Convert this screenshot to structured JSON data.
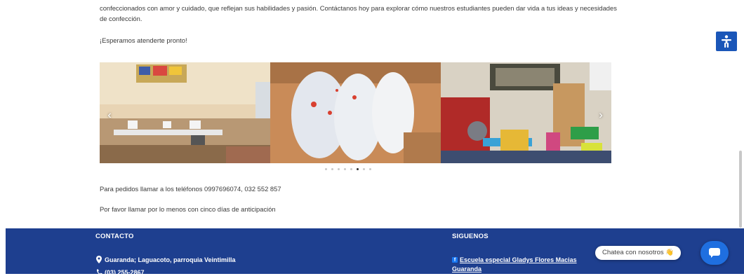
{
  "main": {
    "intro": "confeccionados con amor y cuidado, que reflejan sus habilidades y pasión. Contáctanos hoy para explorar cómo nuestros estudiantes pueden dar vida a tus ideas y necesidades de confección.",
    "greeting": "¡Esperamos atenderte pronto!",
    "orders": "Para pedidos llamar a los teléfonos 0997696074, 032 552 857",
    "notice": "Por favor llamar  por lo menos con cinco días de anticipación"
  },
  "carousel": {
    "prev_icon": "chevron-left-icon",
    "next_icon": "chevron-right-icon",
    "prev": "‹",
    "next": "›",
    "slides": [
      "sewing-room-photo",
      "stuffing-bags-photo",
      "therapy-room-photo"
    ],
    "dot_count": 8,
    "active_dot": 5
  },
  "footer": {
    "contact_heading": "CONTACTO",
    "address": "Guaranda; Laguacoto, parroquia Veintimilla",
    "phone": "(03) 255-2867",
    "follow_heading": "SIGUENOS",
    "facebook_line1": "Escuela especial Gladys Flores Macias",
    "facebook_line2": "Guaranda"
  },
  "widgets": {
    "accessibility_icon": "accessibility-icon",
    "chat_label": "Chatea con nosotros",
    "chat_emoji": "👋",
    "chat_icon": "chat-bubble-icon"
  },
  "colors": {
    "footer_bg": "#1e3f8f",
    "chat_button": "#1f6fe0",
    "accessibility_button": "#1a56b8"
  }
}
